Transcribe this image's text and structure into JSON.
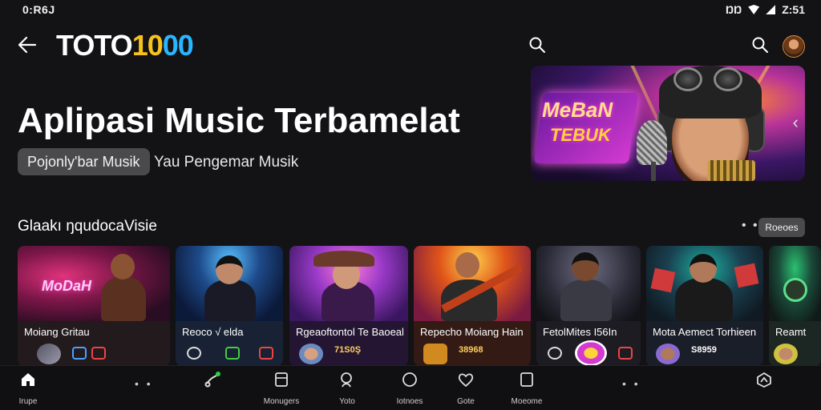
{
  "status": {
    "time_left": "0:R6J",
    "right": "ŊŊ",
    "time_right": "Z:51"
  },
  "header": {
    "logo_white": "TOTO",
    "logo_yellow": "10",
    "logo_blue": "00"
  },
  "hero": {
    "title": "Aplipasi Music Terbamelat",
    "chip": "Pojonly'bar Musik",
    "subtitle": "Yau Pengemar Musik"
  },
  "banner": {
    "sign_line1": "MeBaN",
    "sign_line2": "TEBUK",
    "chevron": "‹"
  },
  "section": {
    "title": "Glaakı ŋqudocaVisie",
    "dots": "• •",
    "button": "Roeoes"
  },
  "cards": [
    {
      "title": "Moiang Gritau",
      "stat": "",
      "stat2": ""
    },
    {
      "title": "Reoco √ elda",
      "stat": "",
      "stat2": ""
    },
    {
      "title": "Rgeaoftontol Te Baoeak",
      "stat": "71S0Ş",
      "stat2": ""
    },
    {
      "title": "Repecho Moiang Hain",
      "stat": "38968",
      "stat2": ""
    },
    {
      "title": "FetolMites I56In",
      "stat": "",
      "stat2": ""
    },
    {
      "title": "Mota Aemect Torhieen",
      "stat": "S8959",
      "stat2": ""
    },
    {
      "title": "Reamt",
      "stat": "",
      "stat2": ""
    }
  ],
  "bottom_nav": [
    {
      "label": "Irupe",
      "icon": "home-icon"
    },
    {
      "label": "",
      "icon": "dots"
    },
    {
      "label": "",
      "icon": "music-note-icon"
    },
    {
      "label": "Monugers",
      "icon": "square-icon"
    },
    {
      "label": "Yoto",
      "icon": "search-icon"
    },
    {
      "label": "Iotnoes",
      "icon": "circle-icon"
    },
    {
      "label": "Gote",
      "icon": "heart-icon"
    },
    {
      "label": "Moeome",
      "icon": "square-icon"
    },
    {
      "label": "",
      "icon": "dots"
    },
    {
      "label": "",
      "icon": "profile-icon"
    }
  ]
}
